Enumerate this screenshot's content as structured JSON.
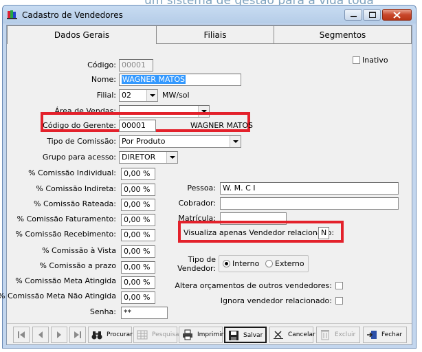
{
  "background_banner": "um sistema de gestão para a vida toda",
  "window": {
    "title": "Cadastro de Vendedores"
  },
  "tabs": [
    "Dados Gerais",
    "Filiais",
    "Segmentos"
  ],
  "form": {
    "codigo_label": "Código:",
    "codigo_value": "00001",
    "nome_label": "Nome:",
    "nome_value": "WAGNER MATOS",
    "filial_label": "Filial:",
    "filial_value": "02",
    "filial_desc": "MW/sol",
    "area_label": "Área de Vendas:",
    "area_value": "",
    "gerente_label": "Código do Gerente:",
    "gerente_value": "00001",
    "gerente_name": "WAGNER MATOS",
    "tipo_comissao_label": "Tipo de Comissão:",
    "tipo_comissao_value": "Por Produto",
    "grupo_label": "Grupo para acesso:",
    "grupo_value": "DIRETOR",
    "inativo_label": "Inativo",
    "comissoes": [
      {
        "label": "% Comissão Individual:",
        "value": "0,00 %"
      },
      {
        "label": "% Comissão Indireta:",
        "value": "0,00 %"
      },
      {
        "label": "% Comissão Rateada:",
        "value": "0,00 %"
      },
      {
        "label": "% Comissão Faturamento:",
        "value": "0,00 %"
      },
      {
        "label": "% Comissão Recebimento:",
        "value": "0,00 %"
      },
      {
        "label": "% Comissão à Vista",
        "value": "0,00 %"
      },
      {
        "label": "% Comissão a prazo",
        "value": "0,00 %"
      },
      {
        "label": "% Comissão Meta Atingida",
        "value": "0,00 %"
      },
      {
        "label": "% Comissão Meta Não Atingida",
        "value": "0,00 %"
      }
    ],
    "senha_label": "Senha:",
    "senha_value": "**",
    "pessoa_label": "Pessoa:",
    "pessoa_value": "W. M. C I",
    "cobrador_label": "Cobrador:",
    "cobrador_value": "",
    "matricula_label": "Matrícula:",
    "matricula_value": "",
    "visualiza_label": "Visualiza apenas Vendedor  relacionado:",
    "visualiza_value": "N",
    "tipo_vendedor_label_1": "Tipo de",
    "tipo_vendedor_label_2": "Vendedor:",
    "interno_label": "Interno",
    "externo_label": "Externo",
    "altera_label": "Altera orçamentos de outros vendedores:",
    "ignora_label": "Ignora vendedor relacionado:"
  },
  "toolbar": {
    "procurar": "Procurar",
    "pesquisa": "Pesquisa",
    "imprimir": "Imprimir",
    "salvar": "Salvar",
    "cancelar": "Cancelar",
    "excluir": "Excluir",
    "fechar": "Fechar"
  },
  "colors": {
    "highlight_red": "#e3212b",
    "selection_blue": "#3399ff"
  }
}
